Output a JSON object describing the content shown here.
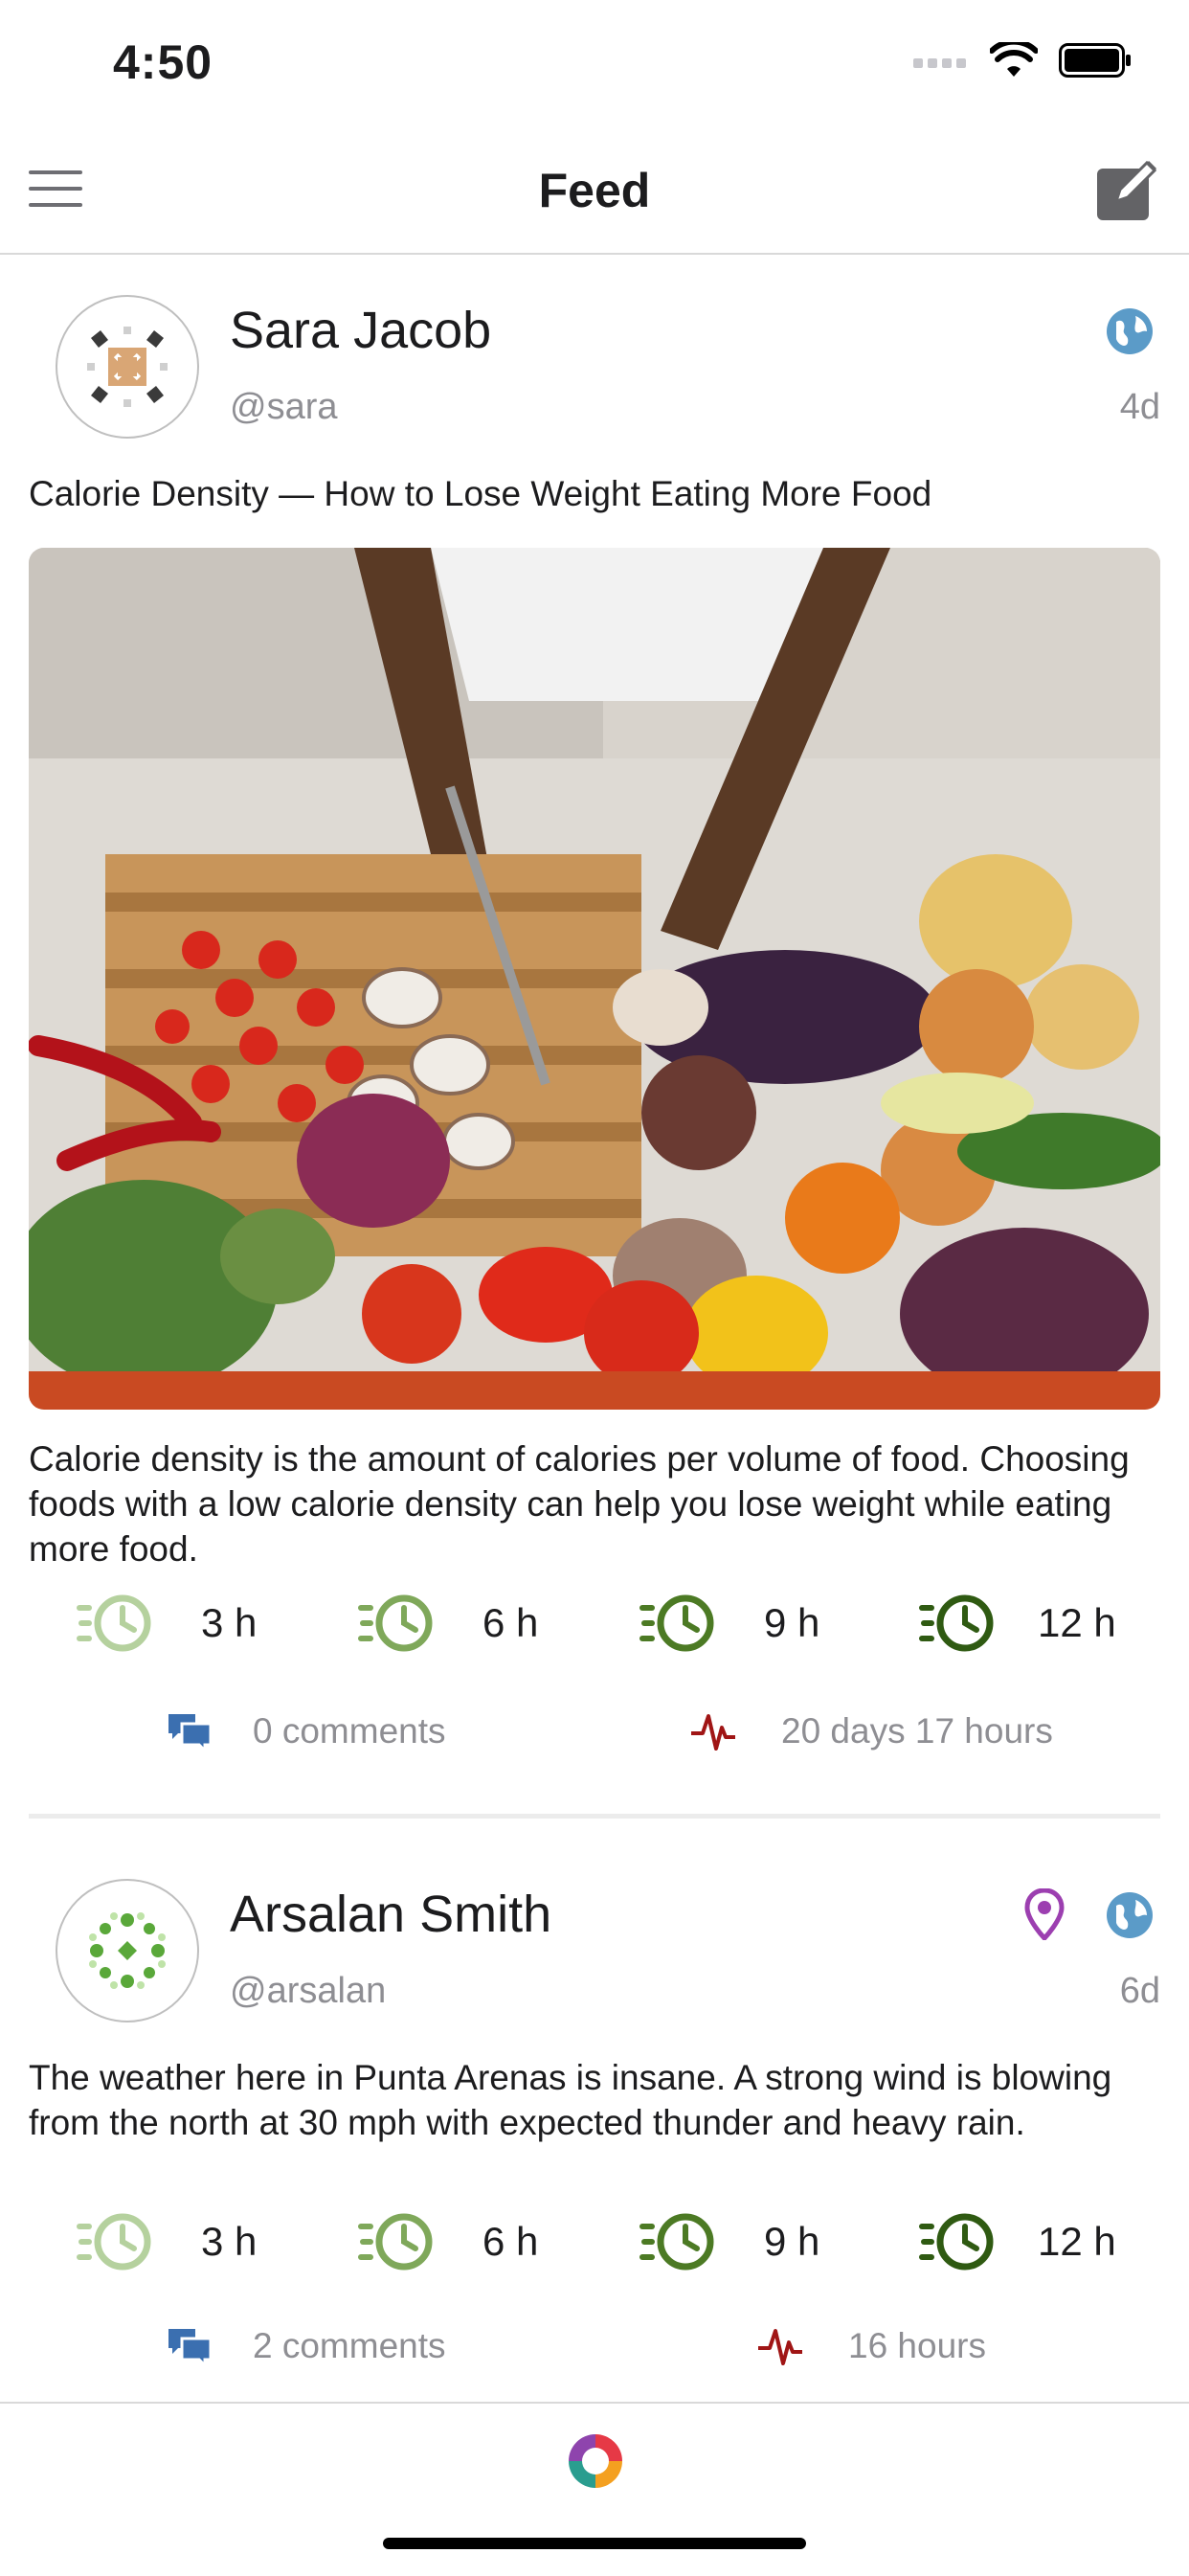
{
  "status_bar": {
    "time": "4:50"
  },
  "nav": {
    "title": "Feed"
  },
  "posts": [
    {
      "author_name": "Sara Jacob",
      "author_handle": "@sara",
      "age": "4d",
      "title": "Calorie Density — How to Lose Weight Eating More Food",
      "body": "Calorie density is the amount of calories per volume of food. Choosing foods with a low calorie density can help you lose weight while eating more food.",
      "timers": [
        "3 h",
        "6 h",
        "9 h",
        "12 h"
      ],
      "comments": "0 comments",
      "activity": "20 days 17 hours"
    },
    {
      "author_name": "Arsalan Smith",
      "author_handle": "@arsalan",
      "age": "6d",
      "body": "The weather here in Punta Arenas is insane. A strong wind is blowing from the north at 30 mph with expected thunder and heavy rain.",
      "timers": [
        "3 h",
        "6 h",
        "9 h",
        "12 h"
      ],
      "comments": "2 comments",
      "activity": "16 hours"
    }
  ],
  "colors": {
    "timer_shades": [
      "#b5d19e",
      "#7fa85a",
      "#4c7a24",
      "#2f5a12"
    ],
    "comment_icon": "#3b6fb0",
    "activity_icon": "#a01515",
    "globe_icon": "#5b9bc8",
    "location_icon": "#9c3fb0"
  },
  "icons": {
    "menu": "hamburger-icon",
    "compose": "compose-icon",
    "globe": "globe-icon",
    "location": "location-pin-icon",
    "timer": "timer-icon",
    "comments": "comments-icon",
    "activity": "heartbeat-icon",
    "tab": "app-logo-icon"
  }
}
